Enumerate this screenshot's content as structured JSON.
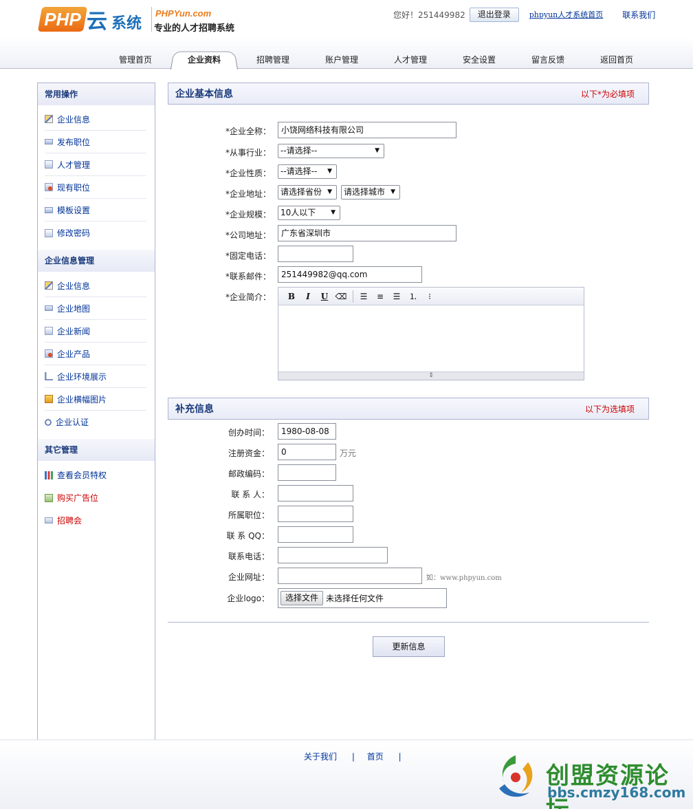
{
  "header": {
    "logo": {
      "php": "PHP",
      "yun": "云",
      "system": "系统",
      "domain": "PHPYun.com",
      "slogan": "专业的人才招聘系统"
    },
    "greeting": "您好！251449982",
    "logout_label": "退出登录",
    "home_link": "phpyun人才系统首页",
    "contact_link": "联系我们"
  },
  "tabs": [
    "管理首页",
    "企业资料",
    "招聘管理",
    "账户管理",
    "人才管理",
    "安全设置",
    "留言反馈",
    "返回首页"
  ],
  "active_tab": "企业资料",
  "sidebar": {
    "groups": [
      {
        "title": "常用操作",
        "items": [
          {
            "label": "企业信息",
            "icon": "edit-icon"
          },
          {
            "label": "发布职位",
            "icon": "post-icon"
          },
          {
            "label": "人才管理",
            "icon": "talent-icon"
          },
          {
            "label": "现有职位",
            "icon": "job-icon"
          },
          {
            "label": "模板设置",
            "icon": "template-icon"
          },
          {
            "label": "修改密码",
            "icon": "password-icon"
          }
        ]
      },
      {
        "title": "企业信息管理",
        "items": [
          {
            "label": "企业信息",
            "icon": "edit-icon"
          },
          {
            "label": "企业地图",
            "icon": "map-icon"
          },
          {
            "label": "企业新闻",
            "icon": "news-icon"
          },
          {
            "label": "企业产品",
            "icon": "product-icon"
          },
          {
            "label": "企业环境展示",
            "icon": "environment-icon"
          },
          {
            "label": "企业横幅图片",
            "icon": "banner-icon"
          },
          {
            "label": "企业认证",
            "icon": "certification-icon"
          }
        ]
      },
      {
        "title": "其它管理",
        "items": [
          {
            "label": "查看会员特权",
            "icon": "chart-icon"
          },
          {
            "label": "购买广告位",
            "icon": "ad-icon"
          },
          {
            "label": "招聘会",
            "icon": "fair-icon"
          }
        ]
      }
    ]
  },
  "basic": {
    "title": "企业基本信息",
    "note": "以下*为必填项",
    "fields": {
      "full_name": {
        "label": "*企业全称：",
        "value": "小饶网络科技有限公司"
      },
      "industry": {
        "label": "*从事行业：",
        "value": "--请选择--"
      },
      "nature": {
        "label": "*企业性质：",
        "value": "--请选择--"
      },
      "location": {
        "label": "*企业地址：",
        "province": "请选择省份",
        "city": "请选择城市"
      },
      "scale": {
        "label": "*企业规模：",
        "value": "10人以下"
      },
      "address": {
        "label": "*公司地址：",
        "value": "广东省深圳市"
      },
      "phone": {
        "label": "*固定电话：",
        "value": ""
      },
      "email": {
        "label": "*联系邮件：",
        "value": "251449982@qq.com"
      },
      "intro": {
        "label": "*企业简介："
      }
    },
    "editor_buttons": [
      "B",
      "I",
      "U",
      "eraser",
      "align-left",
      "align-center",
      "align-right",
      "ordered-list",
      "unordered-list"
    ]
  },
  "extra": {
    "title": "补充信息",
    "note": "以下为选填项",
    "fields": {
      "founded": {
        "label": "创办时间：",
        "value": "1980-08-08"
      },
      "capital": {
        "label": "注册资金：",
        "value": "0",
        "unit": "万元"
      },
      "zip": {
        "label": "邮政编码：",
        "value": ""
      },
      "contact": {
        "label": "联 系 人：",
        "value": ""
      },
      "position": {
        "label": "所属职位：",
        "value": ""
      },
      "qq": {
        "label": "联 系 QQ：",
        "value": ""
      },
      "tel": {
        "label": "联系电话：",
        "value": ""
      },
      "website": {
        "label": "企业网址：",
        "value": "",
        "hint": "如：www.phpyun.com"
      },
      "logo": {
        "label": "企业logo：",
        "button": "选择文件",
        "status": "未选择任何文件"
      }
    }
  },
  "submit_label": "更新信息",
  "footer": {
    "about": "关于我们",
    "home": "首页",
    "sep": "|"
  },
  "watermark": {
    "name": "创盟资源论坛",
    "url": "bbs.cmzy168.com"
  }
}
